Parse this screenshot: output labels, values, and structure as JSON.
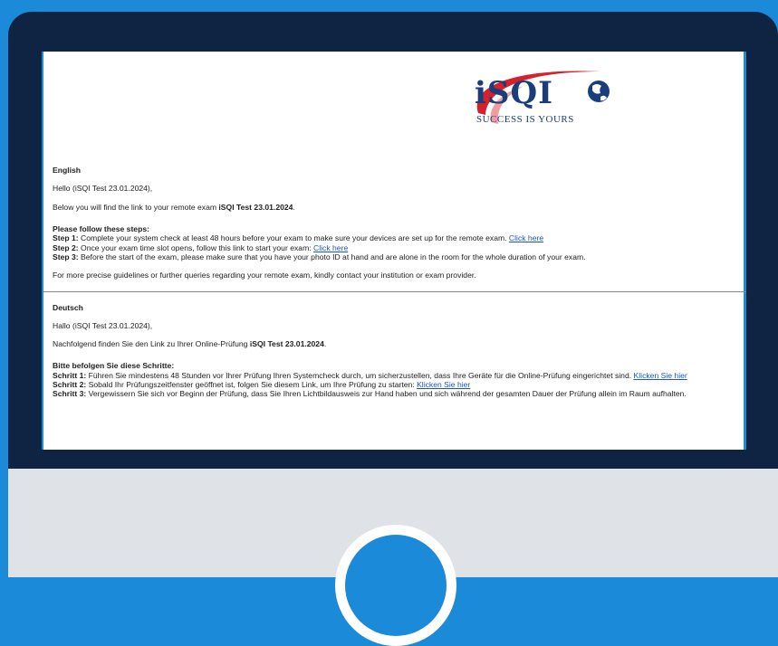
{
  "logo": {
    "brand": "iSQI",
    "tagline": "SUCCESS IS YOURS",
    "registered": "®"
  },
  "english": {
    "title": "English",
    "greeting": "Hello (iSQI Test 23.01.2024),",
    "intro_pre": "Below you will find the link to your remote exam ",
    "intro_exam": "iSQI Test 23.01.2024",
    "intro_post": ".",
    "steps_title": "Please follow these steps:",
    "step1_label": "Step 1:",
    "step1_text": " Complete your system check at least 48 hours before your exam to make sure your devices are set up for the remote exam. ",
    "step1_link": "Click here",
    "step2_label": "Step 2:",
    "step2_text": " Once your exam time slot opens, follow this link to start your exam: ",
    "step2_link": "Click here",
    "step3_label": "Step 3:",
    "step3_text": " Before the start of the exam, please make sure that you have your photo ID at hand and are alone in the room for the whole duration of your exam.",
    "footer": "For more precise guidelines or further queries regarding your remote exam, kindly contact your institution or exam provider."
  },
  "deutsch": {
    "title": "Deutsch",
    "greeting": "Hallo (iSQI Test 23.01.2024),",
    "intro_pre": "Nachfolgend finden Sie den Link zu Ihrer Online-Prüfung ",
    "intro_exam": "iSQI Test 23.01.2024",
    "intro_post": ".",
    "steps_title": "Bitte befolgen Sie diese Schritte:",
    "step1_label": "Schritt 1:",
    "step1_text": " Führen Sie mindestens 48 Stunden vor Ihrer Prüfung Ihren Systemcheck durch, um sicherzustellen, dass Ihre Geräte für die Online-Prüfung eingerichtet sind. ",
    "step1_link": "Klicken Sie hier",
    "step2_label": "Schritt 2:",
    "step2_text": " Sobald Ihr Prüfungszeitfenster geöffnet ist, folgen Sie diesem Link, um Ihre Prüfung zu starten: ",
    "step2_link": "Klicken Sie hier",
    "step3_label": "Schritt 3:",
    "step3_text": " Vergewissern Sie sich vor Beginn der Prüfung, dass Sie Ihren Lichtbildausweis zur Hand haben und sich während der gesamten Dauer der Prüfung allein im Raum aufhalten."
  },
  "colors": {
    "background": "#1b8ad9",
    "device": "#0f2442",
    "brand_blue": "#1a3d7c",
    "swoosh_red": "#d6202a",
    "link": "#1a55c9"
  }
}
